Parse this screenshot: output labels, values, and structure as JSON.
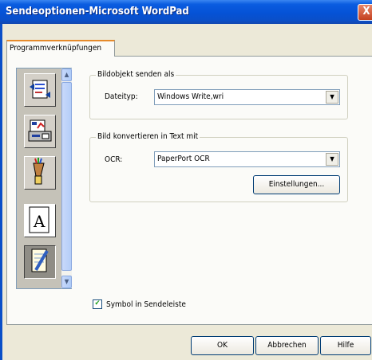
{
  "window": {
    "title": "Sendeoptionen-Microsoft WordPad",
    "close_glyph": "X"
  },
  "tab": {
    "label": "Programmverknüpfungen"
  },
  "iconlist": {
    "items": [
      {
        "icon": "document-send-icon"
      },
      {
        "icon": "fax-printer-icon"
      },
      {
        "icon": "paint-brushes-icon"
      },
      {
        "icon": "text-a-icon",
        "glyph": "A"
      },
      {
        "icon": "notepad-pencil-icon"
      }
    ]
  },
  "bildobjekt": {
    "legend": "Bildobjekt senden als",
    "dateityp_label": "Dateityp:",
    "dateityp_value": "Windows Write,wri"
  },
  "ocr_group": {
    "legend": "Bild konvertieren in Text mit",
    "ocr_label": "OCR:",
    "ocr_value": "PaperPort OCR",
    "settings_button": "Einstellungen..."
  },
  "symbol_checkbox": {
    "label": "Symbol in Sendeleiste",
    "checked": true,
    "mark": "✔"
  },
  "footer": {
    "ok": "OK",
    "cancel": "Abbrechen",
    "help": "Hilfe"
  }
}
